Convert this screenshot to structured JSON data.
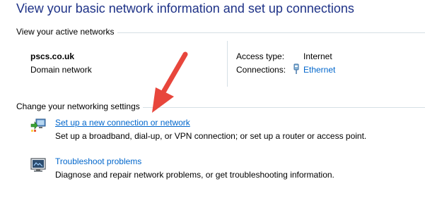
{
  "header": {
    "title": "View your basic network information and set up connections"
  },
  "active_networks": {
    "section_label": "View your active networks",
    "network_name": "pscs.co.uk",
    "network_category": "Domain network",
    "access_type_label": "Access type:",
    "access_type_value": "Internet",
    "connections_label": "Connections:",
    "connections_value": "Ethernet"
  },
  "settings": {
    "section_label": "Change your networking settings",
    "items": [
      {
        "link": "Set up a new connection or network",
        "description": "Set up a broadband, dial-up, or VPN connection; or set up a router or access point.",
        "icon": "new-connection-icon"
      },
      {
        "link": "Troubleshoot problems",
        "description": "Diagnose and repair network problems, or get troubleshooting information.",
        "icon": "troubleshoot-icon"
      }
    ]
  },
  "annotation": {
    "arrow_color": "#e8463c"
  },
  "colors": {
    "title": "#1e3287",
    "link": "#0066cc",
    "rule": "#d5dfe5"
  }
}
